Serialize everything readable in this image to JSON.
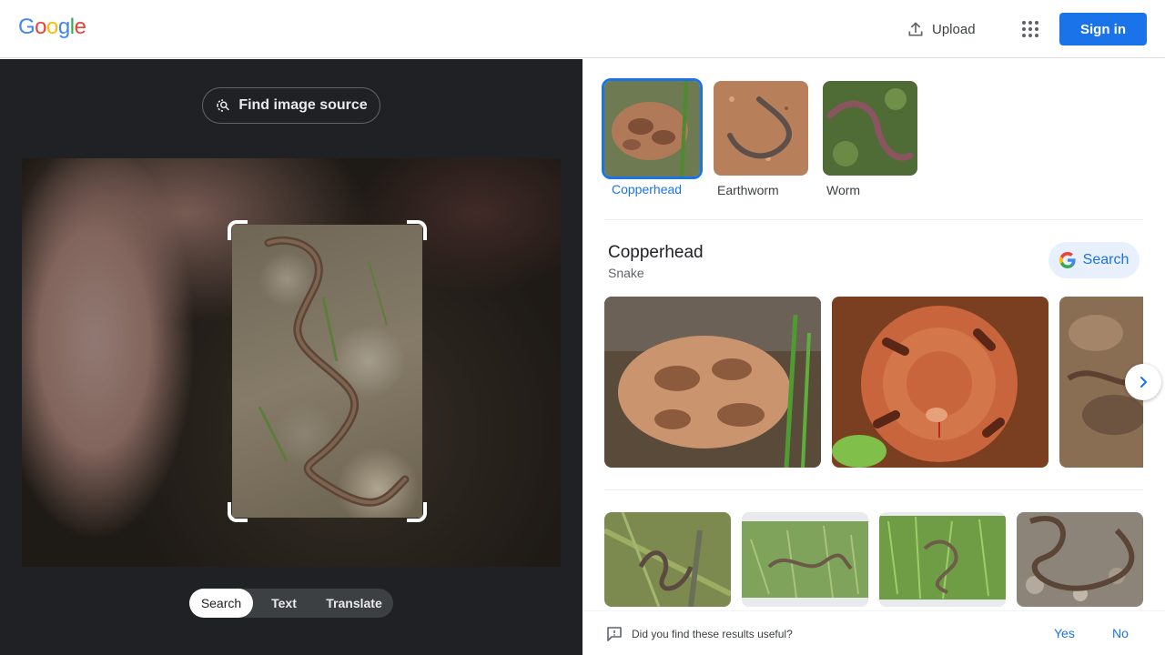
{
  "header": {
    "logo_letters": [
      {
        "char": "G",
        "color": "#4285F4"
      },
      {
        "char": "o",
        "color": "#EA4335"
      },
      {
        "char": "o",
        "color": "#FBBC05"
      },
      {
        "char": "g",
        "color": "#4285F4"
      },
      {
        "char": "l",
        "color": "#34A853"
      },
      {
        "char": "e",
        "color": "#EA4335"
      }
    ],
    "upload_label": "Upload",
    "upload_icon": "upload-icon",
    "apps_icon": "apps-grid-icon",
    "signin_label": "Sign in"
  },
  "left": {
    "find_source_label": "Find image source",
    "find_source_icon": "lens-search-icon",
    "modes": [
      {
        "label": "Search",
        "active": true
      },
      {
        "label": "Text",
        "active": false
      },
      {
        "label": "Translate",
        "active": false
      }
    ]
  },
  "right": {
    "chips": [
      {
        "label": "Copperhead",
        "selected": true
      },
      {
        "label": "Earthworm",
        "selected": false
      },
      {
        "label": "Worm",
        "selected": false
      }
    ],
    "entity": {
      "title": "Copperhead",
      "subtitle": "Snake",
      "search_label": "Search"
    },
    "feedback": {
      "question": "Did you find these results useful?",
      "yes": "Yes",
      "no": "No"
    }
  },
  "colors": {
    "accent": "#1a73e8",
    "left_bg": "#202124",
    "chip_selected_border": "#1a73e8"
  }
}
